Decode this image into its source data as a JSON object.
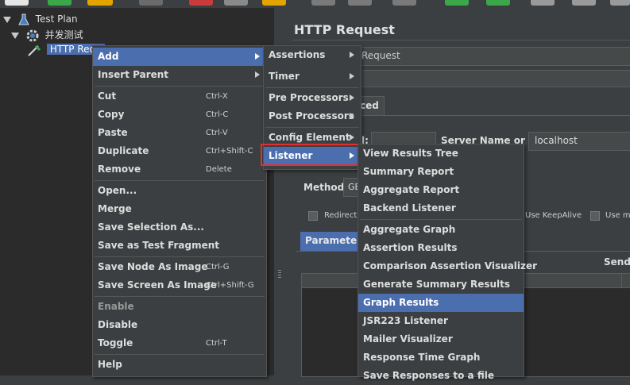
{
  "tree": {
    "test_plan": "Test Plan",
    "thread_group": "并发测试",
    "http_request": "HTTP Requ"
  },
  "panel": {
    "title": "HTTP Request",
    "name_value": "Request",
    "tab_advanced": "ced",
    "protocol_label": "l:",
    "server_label": "Server Name or IP:",
    "server_value": "localhost",
    "method_label": "Method:",
    "method_value": "GE",
    "redirect_label": "Redirect",
    "keepalive_label": "Use KeepAlive",
    "multipart_label": "Use m",
    "parameters_tab": "Parameters",
    "send_label": "Send P"
  },
  "context_menu": {
    "items": [
      {
        "label": "Add",
        "submenu": true
      },
      {
        "label": "Insert Parent",
        "submenu": true
      },
      {
        "label": "Cut",
        "shortcut": "Ctrl-X"
      },
      {
        "label": "Copy",
        "shortcut": "Ctrl-C"
      },
      {
        "label": "Paste",
        "shortcut": "Ctrl-V"
      },
      {
        "label": "Duplicate",
        "shortcut": "Ctrl+Shift-C"
      },
      {
        "label": "Remove",
        "shortcut": "Delete"
      },
      {
        "label": "Open..."
      },
      {
        "label": "Merge"
      },
      {
        "label": "Save Selection As..."
      },
      {
        "label": "Save as Test Fragment"
      },
      {
        "label": "Save Node As Image",
        "shortcut": "Ctrl-G"
      },
      {
        "label": "Save Screen As Image",
        "shortcut": "Ctrl+Shift-G"
      },
      {
        "label": "Enable"
      },
      {
        "label": "Disable"
      },
      {
        "label": "Toggle",
        "shortcut": "Ctrl-T"
      },
      {
        "label": "Help"
      }
    ]
  },
  "add_submenu": {
    "items": [
      "Assertions",
      "Timer",
      "Pre Processors",
      "Post Processors",
      "Config Element",
      "Listener"
    ]
  },
  "listener_submenu": {
    "items": [
      "View Results Tree",
      "Summary Report",
      "Aggregate Report",
      "Backend Listener",
      "Aggregate Graph",
      "Assertion Results",
      "Comparison Assertion Visualizer",
      "Generate Summary Results",
      "Graph Results",
      "JSR223 Listener",
      "Mailer Visualizer",
      "Response Time Graph",
      "Save Responses to a file"
    ]
  },
  "colors": {
    "selection": "#4b6eaf",
    "highlight_border": "#e03030",
    "menu_bg": "#3c3f41",
    "tree_bg": "#2b2b2b"
  }
}
